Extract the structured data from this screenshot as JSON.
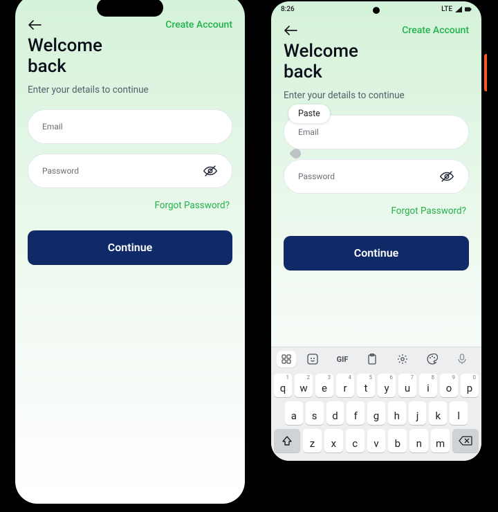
{
  "left": {
    "header": {
      "create_link": "Create Account"
    },
    "title_l1": "Welcome",
    "title_l2": "back",
    "subtitle": "Enter your details to continue",
    "email_placeholder": "Email",
    "email_value": "",
    "password_placeholder": "Password",
    "password_value": "",
    "forgot": "Forgot Password?",
    "cta": "Continue"
  },
  "right": {
    "status": {
      "time": "8:26",
      "net": "LTE"
    },
    "header": {
      "create_link": "Create Account"
    },
    "title_l1": "Welcome",
    "title_l2": "back",
    "subtitle": "Enter your details to continue",
    "paste_label": "Paste",
    "email_placeholder": "Email",
    "email_value": "",
    "password_placeholder": "Password",
    "password_value": "",
    "forgot": "Forgot Password?",
    "cta": "Continue",
    "keyboard": {
      "toolbar_gif": "GIF",
      "row1": [
        {
          "k": "q",
          "n": "1"
        },
        {
          "k": "w",
          "n": "2"
        },
        {
          "k": "e",
          "n": "3"
        },
        {
          "k": "r",
          "n": "4"
        },
        {
          "k": "t",
          "n": "5"
        },
        {
          "k": "y",
          "n": "6"
        },
        {
          "k": "u",
          "n": "7"
        },
        {
          "k": "i",
          "n": "8"
        },
        {
          "k": "o",
          "n": "9"
        },
        {
          "k": "p",
          "n": "0"
        }
      ],
      "row2": [
        {
          "k": "a"
        },
        {
          "k": "s"
        },
        {
          "k": "d"
        },
        {
          "k": "f"
        },
        {
          "k": "g"
        },
        {
          "k": "h"
        },
        {
          "k": "j"
        },
        {
          "k": "k"
        },
        {
          "k": "l"
        }
      ],
      "row3": [
        {
          "k": "z"
        },
        {
          "k": "x"
        },
        {
          "k": "c"
        },
        {
          "k": "v"
        },
        {
          "k": "b"
        },
        {
          "k": "n"
        },
        {
          "k": "m"
        }
      ]
    }
  }
}
